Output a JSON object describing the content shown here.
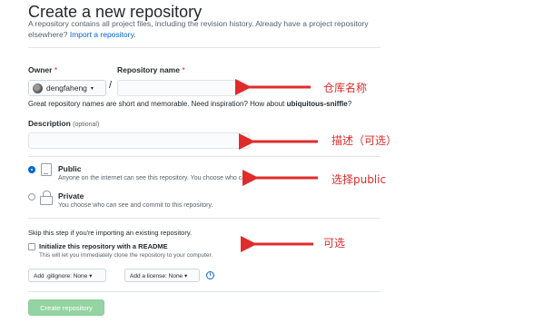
{
  "header": {
    "title": "Create a new repository",
    "subtitle_text": "A repository contains all project files, including the revision history. Already have a project repository elsewhere?",
    "import_link": "Import a repository."
  },
  "owner": {
    "label": "Owner",
    "required_mark": "*",
    "value": "dengfaheng",
    "caret": "▾"
  },
  "repo_name": {
    "label": "Repository name",
    "required_mark": "*",
    "separator": "/",
    "value": ""
  },
  "hint": {
    "prefix": "Great repository names are short and memorable. Need inspiration? How about",
    "suggestion": "ubiquitous-sniffle",
    "suffix": "?"
  },
  "description": {
    "label": "Description",
    "optional": "(optional)",
    "value": ""
  },
  "visibility": {
    "public": {
      "title": "Public",
      "desc": "Anyone on the internet can see this repository. You choose who can",
      "selected": true
    },
    "private": {
      "title": "Private",
      "desc": "You choose who can see and commit to this repository.",
      "selected": false
    }
  },
  "init": {
    "skip_text": "Skip this step if you're importing an existing repository.",
    "readme_label": "Initialize this repository with a README",
    "readme_desc": "This will let you immediately clone the repository to your computer.",
    "readme_checked": false
  },
  "options": {
    "gitignore": "Add .gitignore: None ▾",
    "license": "Add a license: None ▾",
    "info_icon": "i"
  },
  "submit": {
    "label": "Create repository"
  },
  "annotations": {
    "repo_name": "仓库名称",
    "description": "描述（可选）",
    "public": "选择public",
    "readme": "可选",
    "color": "#e12b2b"
  }
}
